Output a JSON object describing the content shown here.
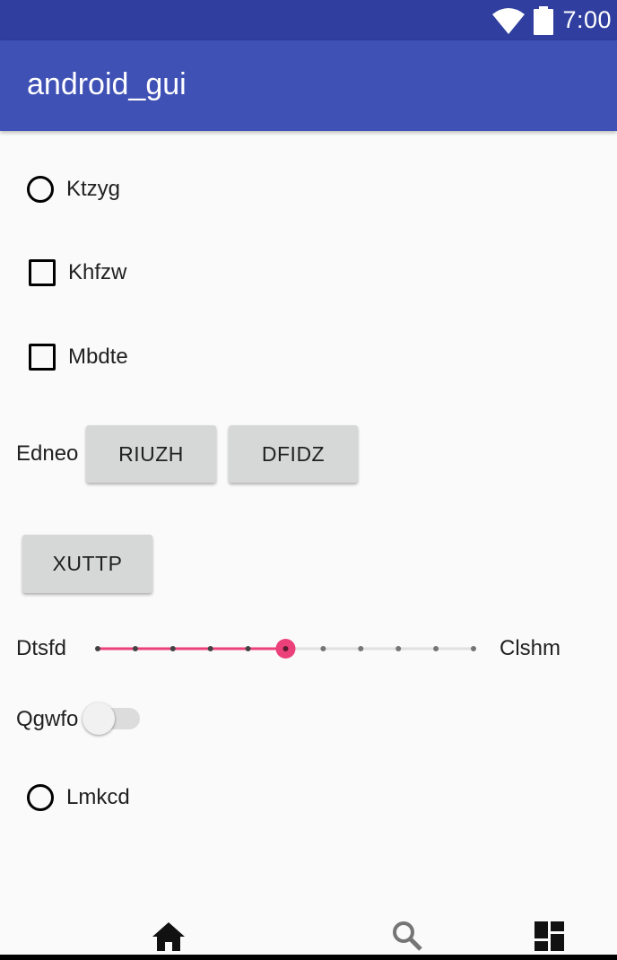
{
  "status_bar": {
    "time": "7:00",
    "icons": [
      "wifi-icon",
      "battery-icon"
    ],
    "color": "#303f9f"
  },
  "app_bar": {
    "title": "android_gui",
    "color": "#3f51b5"
  },
  "controls": {
    "radio1": {
      "label": "Ktzyg",
      "checked": false
    },
    "checkbox1": {
      "label": "Khfzw",
      "checked": false
    },
    "checkbox2": {
      "label": "Mbdte",
      "checked": false
    },
    "button_row": {
      "label": "Edneo",
      "buttons": [
        "RIUZH",
        "DFIDZ"
      ]
    },
    "button_single": "XUTTP",
    "slider": {
      "left_label": "Dtsfd",
      "right_label": "Clshm",
      "steps": 10,
      "value": 5,
      "accent": "#ec407a"
    },
    "switch": {
      "label": "Qgwfo",
      "on": false
    },
    "radio2": {
      "label": "Lmkcd",
      "checked": false
    }
  },
  "bottom_nav": {
    "items": [
      "home-icon",
      "search-icon",
      "dashboard-icon"
    ]
  }
}
